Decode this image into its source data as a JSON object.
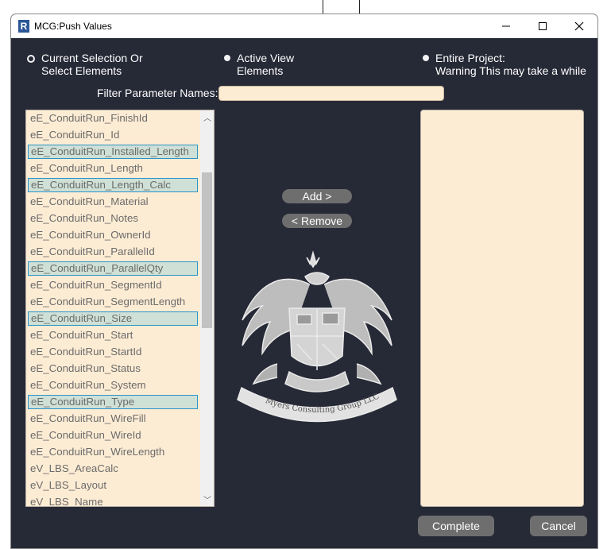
{
  "window": {
    "title": "MCG:Push Values",
    "app_icon_letter": "R"
  },
  "radios": [
    {
      "lines": [
        "Current Selection Or",
        "Select Elements"
      ],
      "selected": false
    },
    {
      "lines": [
        "Active View",
        "Elements"
      ],
      "selected": true
    },
    {
      "lines": [
        "Entire Project:",
        "Warning This may take a while"
      ],
      "selected": true
    }
  ],
  "filter": {
    "label": "Filter Parameter Names:",
    "value": ""
  },
  "param_list": [
    {
      "name": "eE_ConduitRun_FinishId",
      "selected": false
    },
    {
      "name": "eE_ConduitRun_Id",
      "selected": false
    },
    {
      "name": "eE_ConduitRun_Installed_Length",
      "selected": true
    },
    {
      "name": "eE_ConduitRun_Length",
      "selected": false
    },
    {
      "name": "eE_ConduitRun_Length_Calc",
      "selected": true
    },
    {
      "name": "eE_ConduitRun_Material",
      "selected": false
    },
    {
      "name": "eE_ConduitRun_Notes",
      "selected": false
    },
    {
      "name": "eE_ConduitRun_OwnerId",
      "selected": false
    },
    {
      "name": "eE_ConduitRun_ParallelId",
      "selected": false
    },
    {
      "name": "eE_ConduitRun_ParallelQty",
      "selected": true
    },
    {
      "name": "eE_ConduitRun_SegmentId",
      "selected": false
    },
    {
      "name": "eE_ConduitRun_SegmentLength",
      "selected": false
    },
    {
      "name": "eE_ConduitRun_Size",
      "selected": true
    },
    {
      "name": "eE_ConduitRun_Start",
      "selected": false
    },
    {
      "name": "eE_ConduitRun_StartId",
      "selected": false
    },
    {
      "name": "eE_ConduitRun_Status",
      "selected": false
    },
    {
      "name": "eE_ConduitRun_System",
      "selected": false
    },
    {
      "name": "eE_ConduitRun_Type",
      "selected": true
    },
    {
      "name": "eE_ConduitRun_WireFill",
      "selected": false
    },
    {
      "name": "eE_ConduitRun_WireId",
      "selected": false
    },
    {
      "name": "eE_ConduitRun_WireLength",
      "selected": false
    },
    {
      "name": "eV_LBS_AreaCalc",
      "selected": false
    },
    {
      "name": "eV_LBS_Layout",
      "selected": false
    },
    {
      "name": "eV_LBS_Name",
      "selected": false
    }
  ],
  "buttons": {
    "add": "Add >",
    "remove": "< Remove",
    "complete": "Complete",
    "cancel": "Cancel"
  },
  "logo": {
    "banner_text": "Myers Consulting Group LLC"
  },
  "selected_list": [],
  "colors": {
    "background": "#262936",
    "field": "#fdecd4",
    "selection": "#cfe0d6",
    "selection_border": "#2a94c8",
    "button": "#6e6e6e"
  }
}
